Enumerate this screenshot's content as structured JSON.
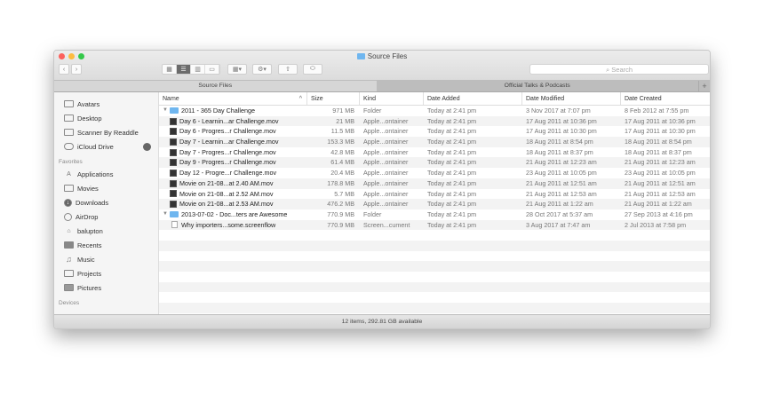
{
  "window": {
    "title": "Source Files",
    "status": "12 items, 292.81 GB available"
  },
  "toolbar": {
    "search_placeholder": "Search",
    "back": "‹",
    "forward": "›"
  },
  "tabs": [
    {
      "label": "Source Files",
      "active": true
    },
    {
      "label": "Official Talks & Podcasts",
      "active": false
    }
  ],
  "tab_add": "+",
  "sidebar": {
    "top_items": [
      {
        "label": "Avatars"
      },
      {
        "label": "Desktop"
      },
      {
        "label": "Scanner By Readdle"
      },
      {
        "label": "iCloud Drive"
      }
    ],
    "favorites_heading": "Favorites",
    "favorites": [
      {
        "label": "Applications"
      },
      {
        "label": "Movies"
      },
      {
        "label": "Downloads"
      },
      {
        "label": "AirDrop"
      },
      {
        "label": "balupton"
      },
      {
        "label": "Recents"
      },
      {
        "label": "Music"
      },
      {
        "label": "Projects"
      },
      {
        "label": "Pictures"
      }
    ],
    "devices_heading": "Devices"
  },
  "columns": {
    "name": "Name",
    "size": "Size",
    "kind": "Kind",
    "added": "Date Added",
    "modified": "Date Modified",
    "created": "Date Created"
  },
  "rows": [
    {
      "type": "folder",
      "name": "2011 - 365 Day Challenge",
      "size": "971 MB",
      "kind": "Folder",
      "added": "Today at 2:41 pm",
      "modified": "3 Nov 2017 at 7:07 pm",
      "created": "8 Feb 2012 at 7:55 pm"
    },
    {
      "type": "movie",
      "name": "Day 6 - Learnin...ar Challenge.mov",
      "size": "21 MB",
      "kind": "Apple...ontainer",
      "added": "Today at 2:41 pm",
      "modified": "17 Aug 2011 at 10:36 pm",
      "created": "17 Aug 2011 at 10:36 pm"
    },
    {
      "type": "movie",
      "name": "Day 6 - Progres...r Challenge.mov",
      "size": "11.5 MB",
      "kind": "Apple...ontainer",
      "added": "Today at 2:41 pm",
      "modified": "17 Aug 2011 at 10:30 pm",
      "created": "17 Aug 2011 at 10:30 pm"
    },
    {
      "type": "movie",
      "name": "Day 7 - Learnin...ar Challenge.mov",
      "size": "153.3 MB",
      "kind": "Apple...ontainer",
      "added": "Today at 2:41 pm",
      "modified": "18 Aug 2011 at 8:54 pm",
      "created": "18 Aug 2011 at 8:54 pm"
    },
    {
      "type": "movie",
      "name": "Day 7 - Progres...r Challenge.mov",
      "size": "42.8 MB",
      "kind": "Apple...ontainer",
      "added": "Today at 2:41 pm",
      "modified": "18 Aug 2011 at 8:37 pm",
      "created": "18 Aug 2011 at 8:37 pm"
    },
    {
      "type": "movie",
      "name": "Day 9 - Progres...r Challenge.mov",
      "size": "61.4 MB",
      "kind": "Apple...ontainer",
      "added": "Today at 2:41 pm",
      "modified": "21 Aug 2011 at 12:23 am",
      "created": "21 Aug 2011 at 12:23 am"
    },
    {
      "type": "movie",
      "name": "Day 12 - Progre...r Challenge.mov",
      "size": "20.4 MB",
      "kind": "Apple...ontainer",
      "added": "Today at 2:41 pm",
      "modified": "23 Aug 2011 at 10:05 pm",
      "created": "23 Aug 2011 at 10:05 pm"
    },
    {
      "type": "movie",
      "name": "Movie on 21-08...at 2.40 AM.mov",
      "size": "178.8 MB",
      "kind": "Apple...ontainer",
      "added": "Today at 2:41 pm",
      "modified": "21 Aug 2011 at 12:51 am",
      "created": "21 Aug 2011 at 12:51 am"
    },
    {
      "type": "movie",
      "name": "Movie on 21-08...at 2.52 AM.mov",
      "size": "5.7 MB",
      "kind": "Apple...ontainer",
      "added": "Today at 2:41 pm",
      "modified": "21 Aug 2011 at 12:53 am",
      "created": "21 Aug 2011 at 12:53 am"
    },
    {
      "type": "movie",
      "name": "Movie on 21-08...at 2.53 AM.mov",
      "size": "476.2 MB",
      "kind": "Apple...ontainer",
      "added": "Today at 2:41 pm",
      "modified": "21 Aug 2011 at 1:22 am",
      "created": "21 Aug 2011 at 1:22 am"
    },
    {
      "type": "folder",
      "name": "2013-07-02 - Doc...ters are Awesome",
      "size": "770.9 MB",
      "kind": "Folder",
      "added": "Today at 2:41 pm",
      "modified": "28 Oct 2017 at 5:37 am",
      "created": "27 Sep 2013 at 4:16 pm"
    },
    {
      "type": "doc",
      "name": "Why importers...some.screenflow",
      "size": "770.9 MB",
      "kind": "Screen...cument",
      "added": "Today at 2:41 pm",
      "modified": "3 Aug 2017 at 7:47 am",
      "created": "2 Jul 2013 at 7:58 pm"
    }
  ]
}
